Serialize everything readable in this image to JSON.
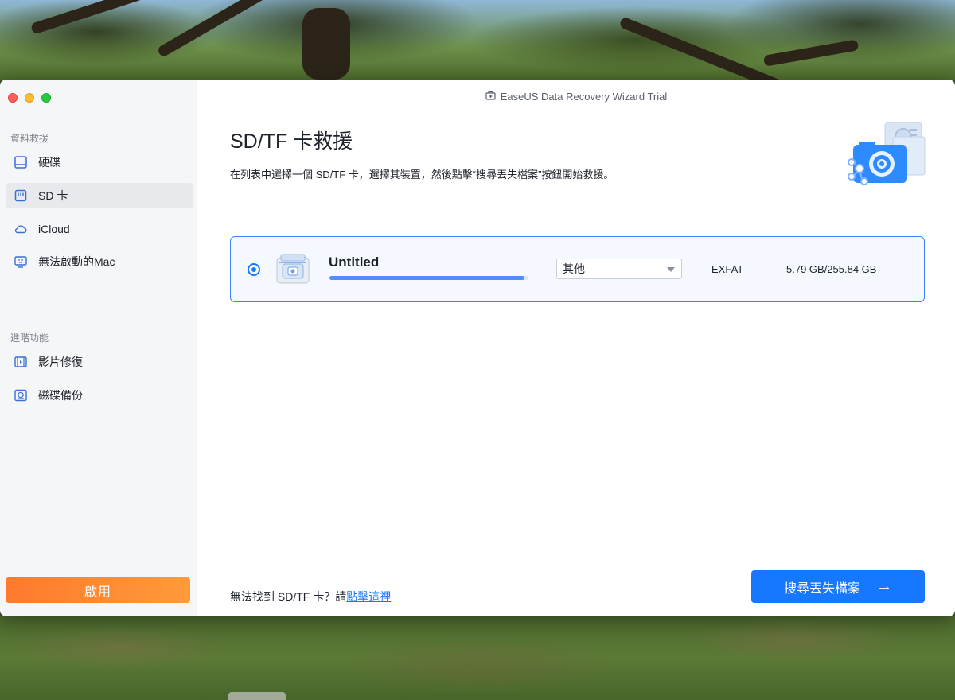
{
  "window": {
    "title": "EaseUS Data Recovery Wizard  Trial"
  },
  "sidebar": {
    "section_recovery": "資料救援",
    "items": [
      {
        "label": "硬碟",
        "icon": "hard-drive-icon"
      },
      {
        "label": "SD 卡",
        "icon": "sd-card-icon",
        "active": true
      },
      {
        "label": "iCloud",
        "icon": "cloud-icon"
      },
      {
        "label": "無法啟動的Mac",
        "icon": "mac-screen-icon"
      }
    ],
    "section_advanced": "進階功能",
    "advanced_items": [
      {
        "label": "影片修復",
        "icon": "video-repair-icon"
      },
      {
        "label": "磁碟備份",
        "icon": "disk-backup-icon"
      }
    ],
    "activate_label": "啟用"
  },
  "main": {
    "title": "SD/TF 卡救援",
    "subtitle": "在列表中選擇一個 SD/TF 卡，選擇其裝置，然後點擊“搜尋丟失檔案”按鈕開始救援。",
    "device": {
      "name": "Untitled",
      "usage_fraction": 0.98,
      "type_selected": "其他",
      "filesystem": "EXFAT",
      "capacity": "5.79 GB/255.84 GB"
    },
    "footer_prefix": "無法找到 SD/TF 卡？請",
    "footer_link": "點擊這裡",
    "scan_label": "搜尋丟失檔案",
    "scan_arrow": "→"
  },
  "colors": {
    "accent": "#1677ff",
    "activate": "#ff8a33"
  }
}
